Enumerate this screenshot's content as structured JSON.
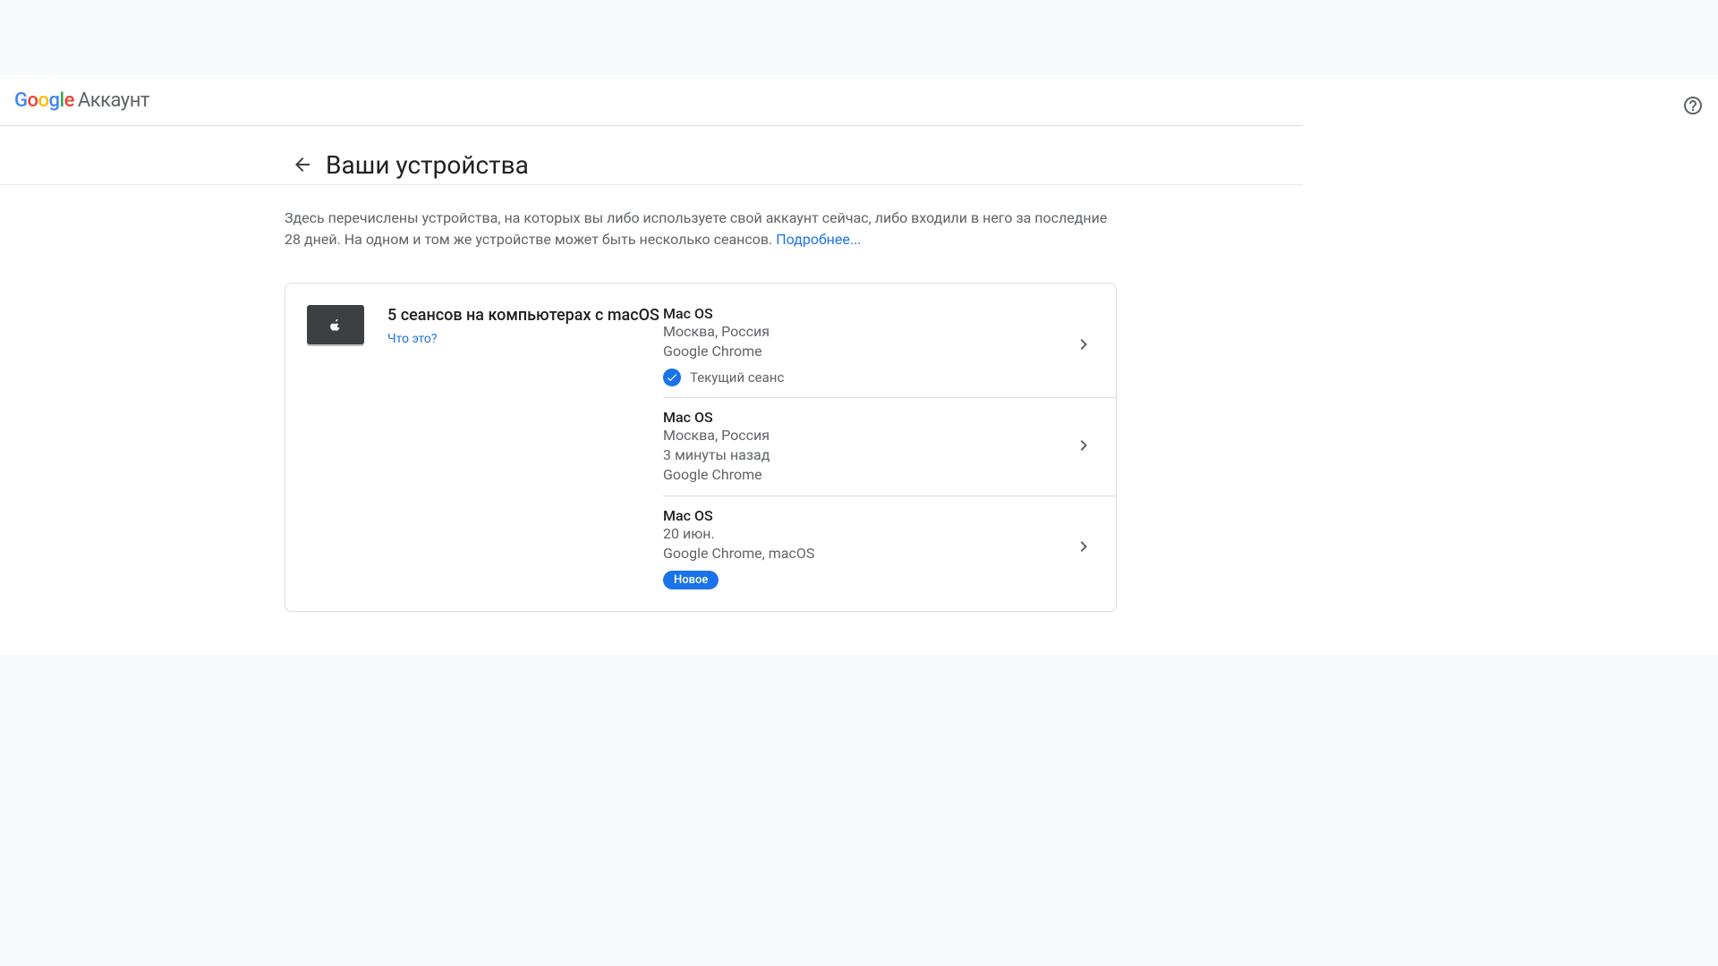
{
  "brand": {
    "letters": [
      "G",
      "o",
      "o",
      "g",
      "l",
      "e"
    ],
    "product": "Аккаунт"
  },
  "page": {
    "title": "Ваши устройства",
    "description": "Здесь перечислены устройства, на которых вы либо используете свой аккаунт сейчас, либо входили в него за последние 28 дней. На одном и том же устройстве может быть несколько сеансов.",
    "learn_more": "Подробнее..."
  },
  "card": {
    "title": "5 сеансов на компьютерах с macOS",
    "what_is_this": "Что это?"
  },
  "sessions": [
    {
      "os": "Mac OS",
      "location": "Москва, Россия",
      "time": "",
      "app": "Google Chrome",
      "current_label": "Текущий сеанс",
      "is_current": true,
      "is_new": false
    },
    {
      "os": "Mac OS",
      "location": "Москва, Россия",
      "time": "3 минуты назад",
      "app": "Google Chrome",
      "is_current": false,
      "is_new": false
    },
    {
      "os": "Mac OS",
      "location": "",
      "time": "20 июн.",
      "app": "Google Chrome, macOS",
      "is_current": false,
      "is_new": true,
      "new_label": "Новое"
    }
  ]
}
